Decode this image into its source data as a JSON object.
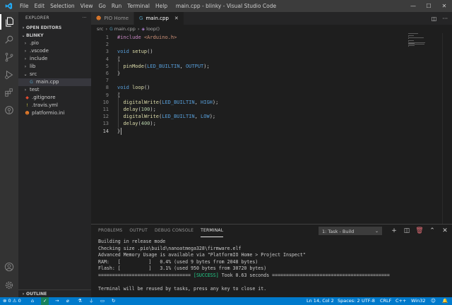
{
  "window": {
    "title": "main.cpp - blinky - Visual Studio Code",
    "menu": [
      "File",
      "Edit",
      "Selection",
      "View",
      "Go",
      "Run",
      "Terminal",
      "Help"
    ],
    "controls": {
      "minimize": "—",
      "maximize": "☐",
      "close": "✕"
    }
  },
  "sidebar": {
    "title": "EXPLORER",
    "more": "···",
    "open_editors": "OPEN EDITORS",
    "project": "BLINKY",
    "tree": [
      {
        "label": ".pio",
        "kind": "folder",
        "expanded": false
      },
      {
        "label": ".vscode",
        "kind": "folder",
        "expanded": false
      },
      {
        "label": "include",
        "kind": "folder",
        "expanded": false
      },
      {
        "label": "lib",
        "kind": "folder",
        "expanded": false
      },
      {
        "label": "src",
        "kind": "folder",
        "expanded": true
      },
      {
        "label": "main.cpp",
        "kind": "cpp",
        "selected": true
      },
      {
        "label": "test",
        "kind": "folder",
        "expanded": false
      },
      {
        "label": ".gitignore",
        "kind": "git"
      },
      {
        "label": ".travis.yml",
        "kind": "yml"
      },
      {
        "label": "platformio.ini",
        "kind": "pio"
      }
    ],
    "outline": "OUTLINE"
  },
  "tabs": [
    {
      "label": "PIO Home",
      "active": false
    },
    {
      "label": "main.cpp",
      "active": true
    }
  ],
  "breadcrumb": {
    "folder": "src",
    "file": "main.cpp",
    "symbol": "loop()"
  },
  "editor": {
    "current_line": 14,
    "lines": [
      [
        [
          "inc",
          "#include "
        ],
        [
          "str",
          "<Arduino.h>"
        ]
      ],
      [],
      [
        [
          "kw",
          "void "
        ],
        [
          "fn",
          "setup"
        ],
        [
          "pl",
          "()"
        ]
      ],
      [
        [
          "pl",
          "{"
        ]
      ],
      [
        [
          "pl",
          "  "
        ],
        [
          "fn",
          "pinMode"
        ],
        [
          "pl",
          "("
        ],
        [
          "mac",
          "LED_BUILTIN"
        ],
        [
          "pl",
          ", "
        ],
        [
          "mac",
          "OUTPUT"
        ],
        [
          "pl",
          ");"
        ]
      ],
      [
        [
          "pl",
          "}"
        ]
      ],
      [],
      [
        [
          "kw",
          "void "
        ],
        [
          "fn",
          "loop"
        ],
        [
          "pl",
          "()"
        ]
      ],
      [
        [
          "pl",
          "{"
        ]
      ],
      [
        [
          "pl",
          "  "
        ],
        [
          "fn",
          "digitalWrite"
        ],
        [
          "pl",
          "("
        ],
        [
          "mac",
          "LED_BUILTIN"
        ],
        [
          "pl",
          ", "
        ],
        [
          "mac",
          "HIGH"
        ],
        [
          "pl",
          ");"
        ]
      ],
      [
        [
          "pl",
          "  "
        ],
        [
          "fn",
          "delay"
        ],
        [
          "pl",
          "("
        ],
        [
          "num",
          "100"
        ],
        [
          "pl",
          ");"
        ]
      ],
      [
        [
          "pl",
          "  "
        ],
        [
          "fn",
          "digitalWrite"
        ],
        [
          "pl",
          "("
        ],
        [
          "mac",
          "LED_BUILTIN"
        ],
        [
          "pl",
          ", "
        ],
        [
          "mac",
          "LOW"
        ],
        [
          "pl",
          ");"
        ]
      ],
      [
        [
          "pl",
          "  "
        ],
        [
          "fn",
          "delay"
        ],
        [
          "pl",
          "("
        ],
        [
          "num",
          "400"
        ],
        [
          "pl",
          ");"
        ]
      ],
      [
        [
          "pl",
          "}"
        ]
      ]
    ]
  },
  "panel": {
    "tabs": [
      "PROBLEMS",
      "OUTPUT",
      "DEBUG CONSOLE",
      "TERMINAL"
    ],
    "active_tab": "TERMINAL",
    "task": "1: Task - Build",
    "terminal": [
      "Building in release mode",
      "Checking size .pio\\build\\nanoatmega328\\firmware.elf",
      "Advanced Memory Usage is available via \"PlatformIO Home > Project Inspect\"",
      "RAM:   [          ]   0.4% (used 9 bytes from 2048 bytes)",
      "Flash: [          ]   3.1% (used 950 bytes from 30720 bytes)"
    ],
    "success_prefix": "================================= ",
    "success_tag": "[SUCCESS]",
    "success_suffix": " Took 0.63 seconds ==========================================",
    "reuse_msg": "Terminal will be reused by tasks, press any key to close it."
  },
  "statusbar": {
    "errors": "0",
    "warnings": "0",
    "position": "Ln 14, Col 2",
    "spaces": "Spaces: 2",
    "encoding": "UTF-8",
    "eol": "CRLF",
    "language": "C++",
    "platform": "Win32"
  },
  "colors": {
    "accent": "#007acc",
    "success": "#23d18b"
  }
}
